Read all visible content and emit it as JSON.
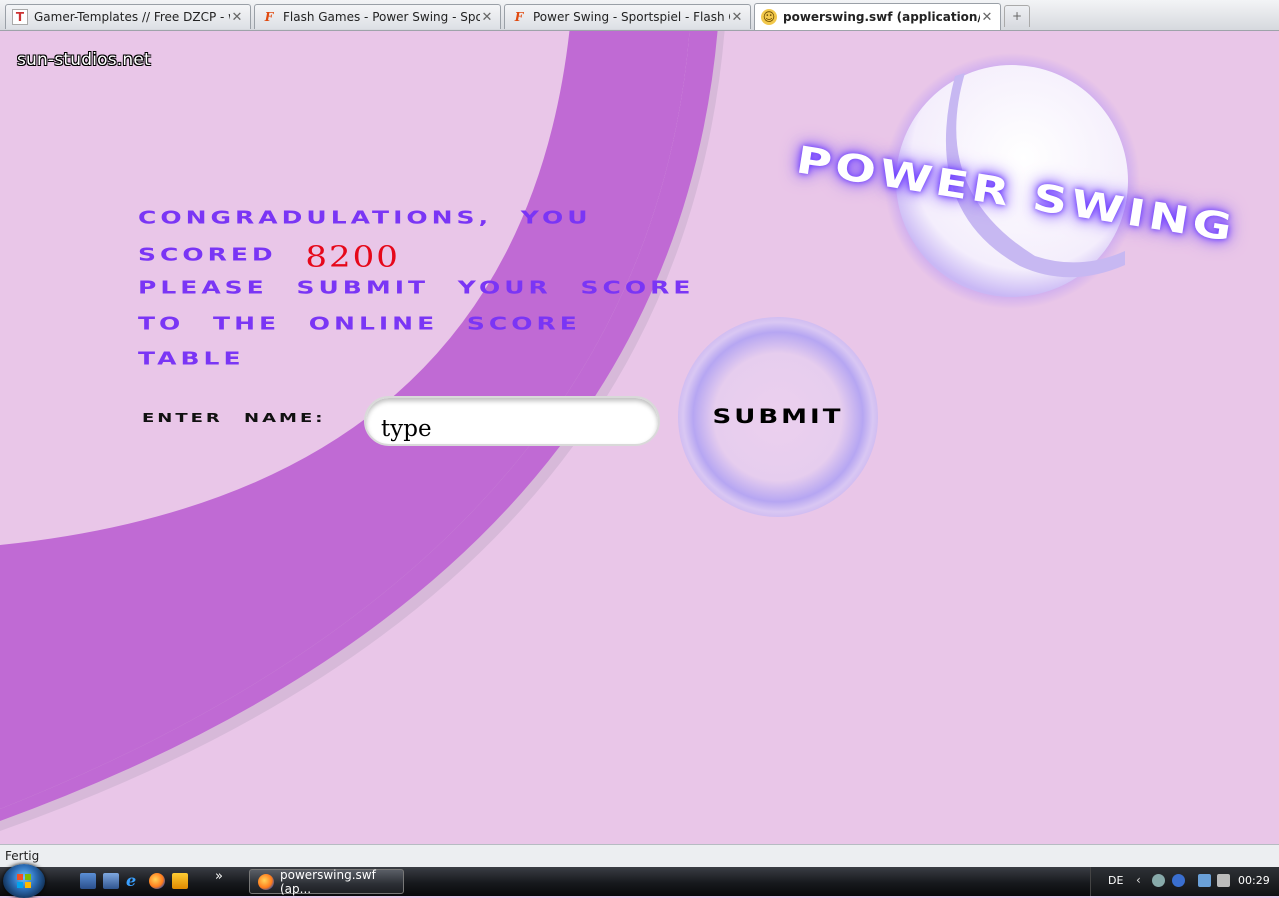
{
  "browser": {
    "tabs": [
      {
        "title": "Gamer-Templates // Free DZCP - w...",
        "icon": "gamer-templates-favicon",
        "active": false
      },
      {
        "title": "Flash Games - Power Swing - Sports...",
        "icon": "flash-favicon",
        "active": false
      },
      {
        "title": "Power Swing - Sportspiel - Flash Ga...",
        "icon": "flash-favicon",
        "active": false
      },
      {
        "title": "powerswing.swf (application/x-sh...",
        "icon": "plugin-favicon",
        "active": true
      }
    ],
    "new_tab_symbol": "+",
    "status_text": "Fertig"
  },
  "game": {
    "site_credit": "sun-studios.net",
    "logo_text": "POWER SWING",
    "message_line1": "CONGRADULATIONS, YOU",
    "message_line2_prefix": "SCORED",
    "score": "8200",
    "message_line3": "PLEASE SUBMIT YOUR SCORE",
    "message_line4": "TO THE ONLINE SCORE",
    "message_line5": "TABLE",
    "enter_name_label": "ENTER NAME:",
    "name_value": "type",
    "submit_label": "SUBMIT",
    "colors": {
      "background": "#e9c6e8",
      "arc": "#c06ad4",
      "message": "#7a35f5",
      "score": "#e6081a"
    }
  },
  "taskbar": {
    "task_button_label": "powerswing.swf (ap...",
    "more_symbol": "»",
    "language": "DE",
    "tray_arrow": "‹",
    "clock": "00:29"
  }
}
